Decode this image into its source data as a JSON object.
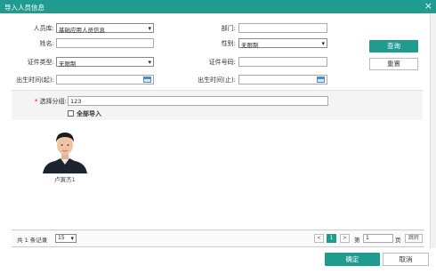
{
  "dialog": {
    "title": "导入人员信息",
    "close_icon": "×"
  },
  "form": {
    "person_db_label": "人员库:",
    "person_db_value": "基础应用人员信息",
    "department_label": "部门:",
    "department_value": "",
    "name_label": "姓名:",
    "name_value": "",
    "gender_label": "性别:",
    "gender_value": "无限制",
    "id_type_label": "证件类型:",
    "id_type_value": "无限制",
    "id_number_label": "证件号码:",
    "id_number_value": "",
    "birth_start_label": "出生时间(起):",
    "birth_start_value": "",
    "birth_end_label": "出生时间(止):",
    "birth_end_value": "",
    "group_label": "选择分组:",
    "group_value": "123",
    "import_all_label": "全部导入"
  },
  "buttons": {
    "query": "查询",
    "reset": "重置",
    "ok": "确定",
    "cancel": "取消"
  },
  "results": {
    "persons": [
      {
        "name": "卢寅杰1"
      }
    ]
  },
  "pager": {
    "total_text": "共 1 条记录",
    "page_size": "15",
    "prev": "<",
    "current_page": "1",
    "next": ">",
    "goto_prefix": "第",
    "goto_value": "1",
    "goto_suffix": "页",
    "jump": "跳转"
  },
  "colors": {
    "accent": "#1f9b90",
    "required": "#e00000"
  }
}
